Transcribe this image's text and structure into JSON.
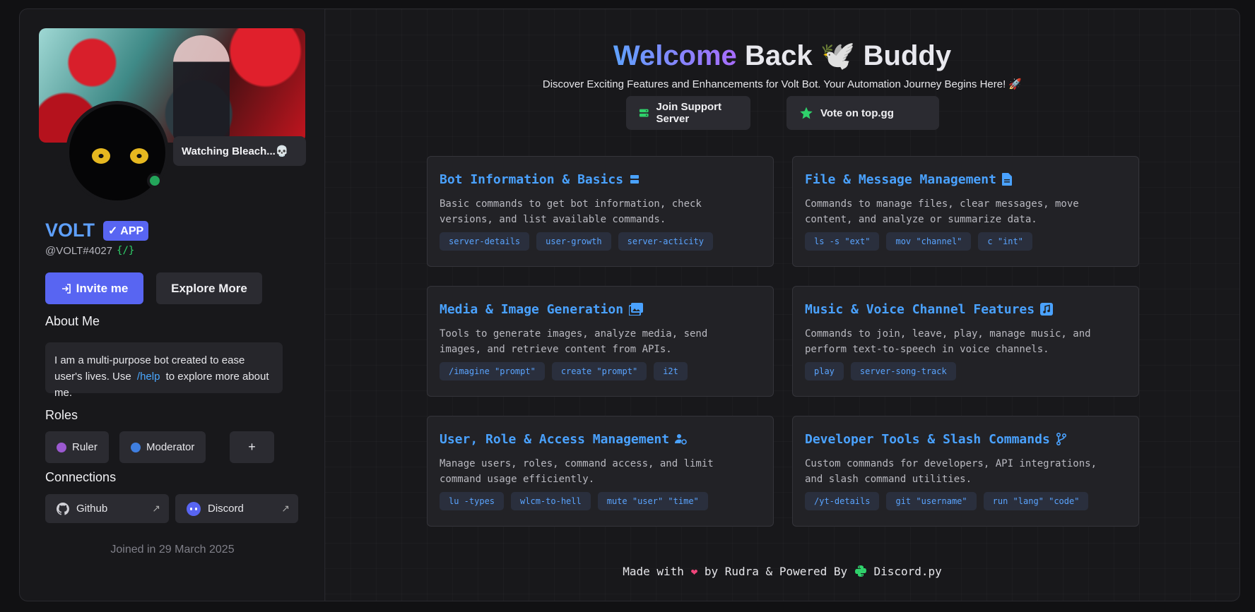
{
  "profile": {
    "activity": "Watching Bleach...💀",
    "name": "VOLT",
    "app_badge": "✓ APP",
    "handle": "@VOLT#4027",
    "handle_code": "{/}",
    "invite_label": "Invite me",
    "explore_label": "Explore More",
    "about_title": "About Me",
    "about_text_before": "I am a multi-purpose bot created to ease user's lives. Use",
    "about_command": "/help",
    "about_text_after": "to explore more about me.",
    "roles_title": "Roles",
    "roles": [
      {
        "label": "Ruler",
        "color": "#9b59d0"
      },
      {
        "label": "Moderator",
        "color": "#3f7fe0"
      }
    ],
    "add_role_label": "+",
    "connections_title": "Connections",
    "connections": [
      {
        "label": "Github",
        "icon": "github-icon"
      },
      {
        "label": "Discord",
        "icon": "discord-icon"
      }
    ],
    "joined": "Joined in 29 March 2025"
  },
  "header": {
    "title_highlight": "Welcome",
    "title_rest_1": "Back",
    "title_emoji": "🕊️",
    "title_rest_2": "Buddy",
    "subtitle": "Discover Exciting Features and Enhancements for Volt Bot. Your Automation Journey Begins Here! 🚀",
    "support_label": "Join Support Server",
    "vote_label": "Vote on top.gg"
  },
  "cards": [
    {
      "title": "Bot Information & Basics",
      "icon": "server-icon",
      "desc": "Basic commands to get bot information, check versions, and list available commands.",
      "tags": [
        "server-details",
        "user-growth",
        "server-acticity"
      ]
    },
    {
      "title": "File & Message Management",
      "icon": "file-icon",
      "desc": "Commands to manage files, clear messages, move content, and analyze or summarize data.",
      "tags": [
        "ls -s \"ext\"",
        "mov \"channel\"",
        "c \"int\""
      ]
    },
    {
      "title": "Media & Image Generation",
      "icon": "images-icon",
      "desc": "Tools to generate images, analyze media, send images, and retrieve content from APIs.",
      "tags": [
        "/imagine \"prompt\"",
        "create \"prompt\"",
        "i2t"
      ]
    },
    {
      "title": "Music & Voice Channel Features",
      "icon": "music-icon",
      "desc": "Commands to join, leave, play, manage music, and perform text-to-speech in voice channels.",
      "tags": [
        "play",
        "server-song-track"
      ]
    },
    {
      "title": "User, Role & Access Management",
      "icon": "user-gear-icon",
      "desc": "Manage users, roles, command access, and limit command usage efficiently.",
      "tags": [
        "lu -types",
        "wlcm-to-hell",
        "mute \"user\" \"time\""
      ]
    },
    {
      "title": "Developer Tools & Slash Commands",
      "icon": "git-branch-icon",
      "desc": "Custom commands for developers, API integrations, and slash command utilities.",
      "tags": [
        "/yt-details",
        "git \"username\"",
        "run \"lang\" \"code\""
      ]
    }
  ],
  "footer": {
    "made_with": "Made with",
    "by": "by Rudra & Powered By",
    "powered": "Discord.py"
  },
  "colors": {
    "accent": "#5865f2",
    "card_title": "#4aa2ff",
    "online": "#23a55a"
  }
}
